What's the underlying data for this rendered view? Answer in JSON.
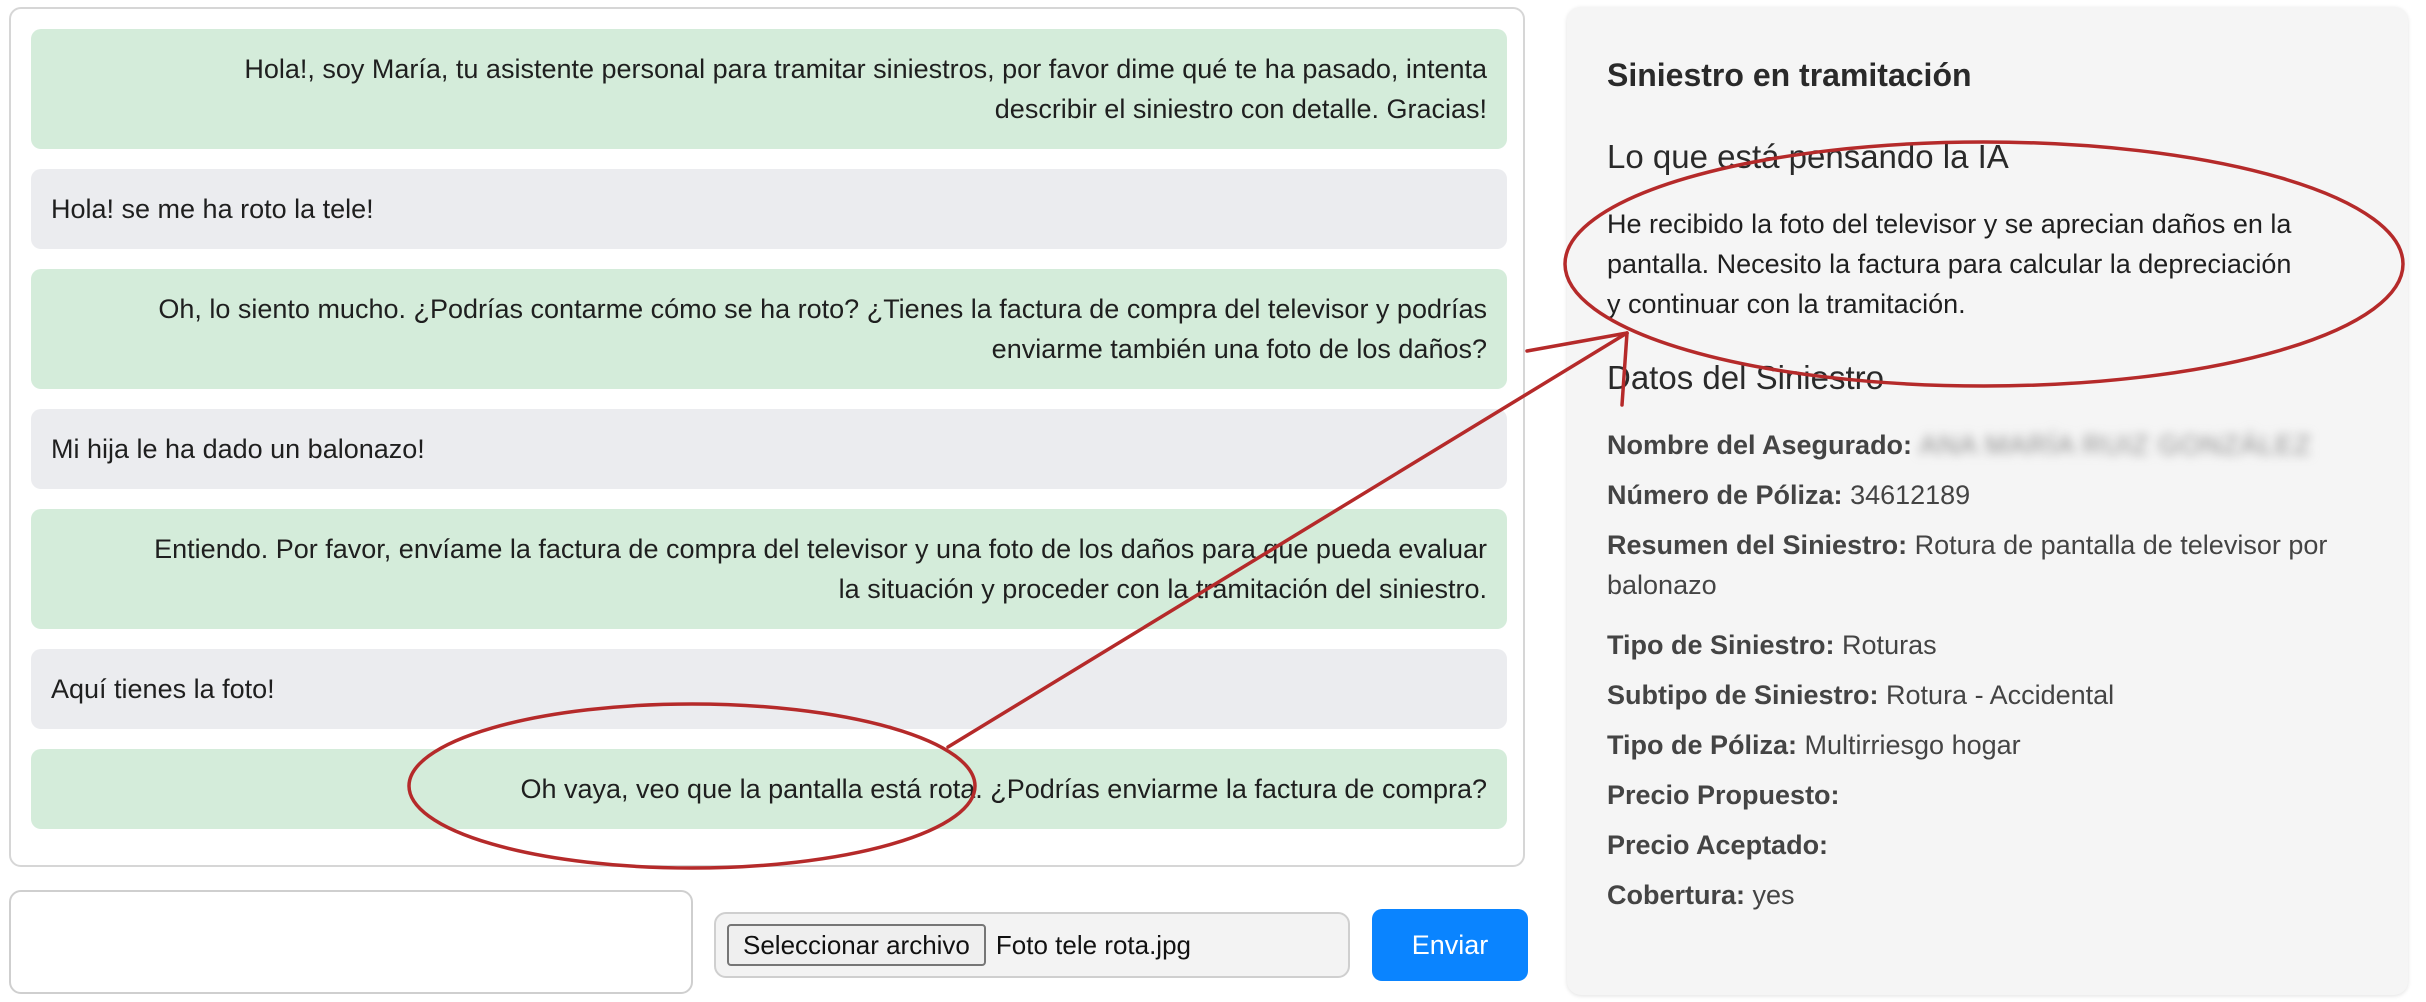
{
  "chat": {
    "messages": [
      {
        "role": "bot",
        "lines": [
          "Hola!, soy María, tu asistente personal para tramitar siniestros, por favor dime qué te ha pasado, intenta",
          "describir el siniestro con detalle. Gracias!"
        ]
      },
      {
        "role": "user",
        "lines": [
          "Hola! se me ha roto la tele!"
        ]
      },
      {
        "role": "bot",
        "lines": [
          "Oh, lo siento mucho. ¿Podrías contarme cómo se ha roto? ¿Tienes la factura de compra del televisor y podrías",
          "enviarme también una foto de los daños?"
        ]
      },
      {
        "role": "user",
        "lines": [
          "Mi hija le ha dado un balonazo!"
        ]
      },
      {
        "role": "bot",
        "lines": [
          "Entiendo. Por favor, envíame la factura de compra del televisor y una foto de los daños para que pueda evaluar",
          "la situación y proceder con la tramitación del siniestro."
        ]
      },
      {
        "role": "user",
        "lines": [
          "Aquí tienes la foto!"
        ]
      },
      {
        "role": "bot",
        "lines": [
          "Oh vaya, veo que la pantalla está rota. ¿Podrías enviarme la factura de compra?"
        ]
      }
    ]
  },
  "input": {
    "message_value": "",
    "file_button_label": "Seleccionar archivo",
    "file_name": "Foto tele rota.jpg",
    "send_label": "Enviar"
  },
  "panel": {
    "title": "Siniestro en tramitación",
    "ai_section_title": "Lo que está pensando la IA",
    "ai_thought_lines": [
      "He recibido la foto del televisor y se aprecian daños en la",
      "pantalla. Necesito la factura para calcular la depreciación",
      "y continuar con la tramitación."
    ],
    "data_section_title": "Datos del Siniestro",
    "fields": [
      {
        "label": "Nombre del Asegurado:",
        "value": "ANA MARÍA RUIZ GONZÁLEZ",
        "blurred": true
      },
      {
        "label": "Número de Póliza:",
        "value": "34612189"
      },
      {
        "label": "Resumen del Siniestro:",
        "value": "Rotura de pantalla de televisor por balonazo"
      },
      {
        "label": "Tipo de Siniestro:",
        "value": "Roturas"
      },
      {
        "label": "Subtipo de Siniestro:",
        "value": "Rotura - Accidental"
      },
      {
        "label": "Tipo de Póliza:",
        "value": "Multirriesgo hogar"
      },
      {
        "label": "Precio Propuesto:",
        "value": ""
      },
      {
        "label": "Precio Aceptado:",
        "value": ""
      },
      {
        "label": "Cobertura:",
        "value": "yes"
      }
    ]
  },
  "colors": {
    "bot_bubble": "#d4ecda",
    "user_bubble": "#ebecef",
    "send_button": "#0a84ff",
    "annotation": "#b52a2a"
  }
}
